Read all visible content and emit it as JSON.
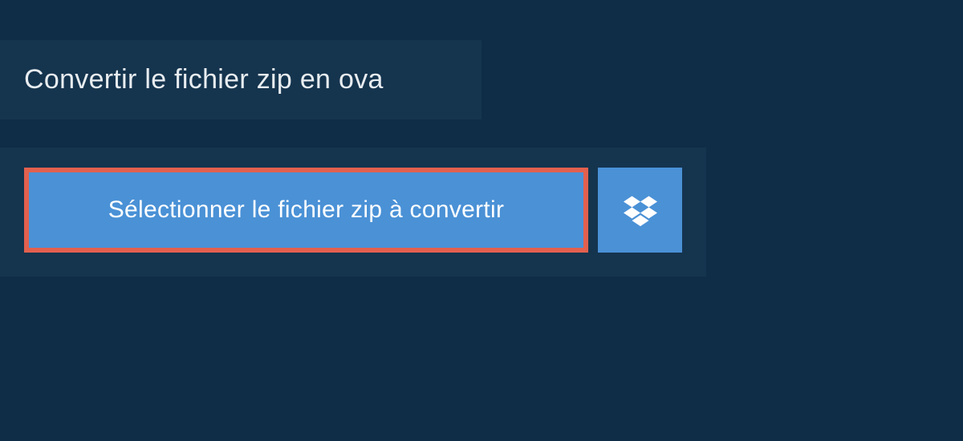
{
  "header": {
    "title": "Convertir le fichier zip en ova"
  },
  "upload": {
    "select_button_label": "Sélectionner le fichier zip à convertir"
  },
  "colors": {
    "background_dark": "#0f2d46",
    "panel": "#15344e",
    "button_primary": "#4a91d6",
    "highlight_border": "#e2604e",
    "text_light": "#e8edf0"
  }
}
